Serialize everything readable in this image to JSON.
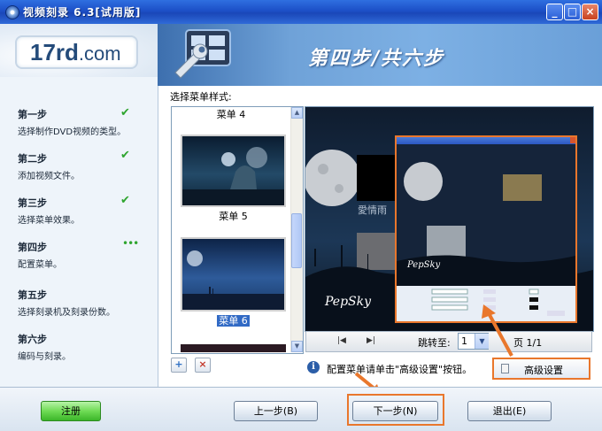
{
  "window": {
    "title": "视频刻录 6.3[试用版]",
    "buttons": {
      "minimize": "_",
      "maximize": "□",
      "close": "×"
    }
  },
  "logo": {
    "text_big": "17rd",
    "text_small": ".com"
  },
  "header": {
    "step_title": "第四步/共六步"
  },
  "steps": [
    {
      "title": "第一步",
      "desc": "选择制作DVD视频的类型。",
      "status": "done"
    },
    {
      "title": "第二步",
      "desc": "添加视频文件。",
      "status": "done"
    },
    {
      "title": "第三步",
      "desc": "选择菜单效果。",
      "status": "done"
    },
    {
      "title": "第四步",
      "desc": "配置菜单。",
      "status": "current"
    },
    {
      "title": "第五步",
      "desc": "选择刻录机及刻录份数。",
      "status": "pending"
    },
    {
      "title": "第六步",
      "desc": "编码与刻录。",
      "status": "pending"
    }
  ],
  "status_icons": {
    "done": "✔",
    "current": "•••"
  },
  "menu_style": {
    "label": "选择菜单样式:",
    "thumbnails": [
      {
        "label": "菜单 4"
      },
      {
        "label": "菜单 5"
      },
      {
        "label": "菜单 6",
        "selected": true
      }
    ]
  },
  "preview": {
    "caption": "PepSky",
    "inset_caption": "PepSky",
    "menu_text": "愛情雨",
    "nav": {
      "first": "|◀",
      "last": "▶|",
      "jump_label": "跳转至:",
      "page_value": "1",
      "page_count": "页 1/1"
    }
  },
  "info": {
    "icon": "i",
    "text": "配置菜单请单击\"高级设置\"按钮。"
  },
  "advanced_button": {
    "label": "高级设置"
  },
  "list_buttons": {
    "add": "+",
    "remove": "×"
  },
  "bottom": {
    "register": "注册",
    "prev": "上一步(B)",
    "next": "下一步(N)",
    "exit": "退出(E)"
  },
  "colors": {
    "accent_orange": "#e9772c",
    "check_green": "#2fa52f",
    "title_blue": "#1c4fc7"
  }
}
